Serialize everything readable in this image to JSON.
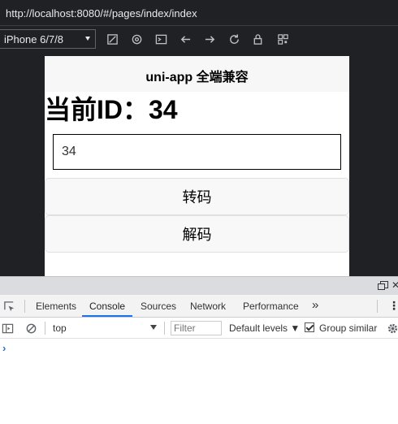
{
  "browser": {
    "url": "http://localhost:8080/#/pages/index/index"
  },
  "device_toolbar": {
    "device": "iPhone 6/7/8",
    "icons": [
      "responsive-icon",
      "sensors-icon",
      "terminal-icon",
      "back-arrow-icon",
      "forward-arrow-icon",
      "reload-icon",
      "lock-icon",
      "qr-code-icon"
    ]
  },
  "app": {
    "nav_title": "uni-app 全端兼容",
    "heading": "当前ID：34",
    "input_value": "34",
    "encode_button": "转码",
    "decode_button": "解码"
  },
  "devtools": {
    "tabs": [
      "Elements",
      "Console",
      "Sources",
      "Network",
      "Performance"
    ],
    "active_tab": "Console",
    "more_tabs": "»",
    "context": "top",
    "filter_placeholder": "Filter",
    "levels": "Default levels",
    "group_similar": "Group similar",
    "group_similar_checked": true,
    "prompt": "›",
    "accent": "#1a73e8"
  }
}
